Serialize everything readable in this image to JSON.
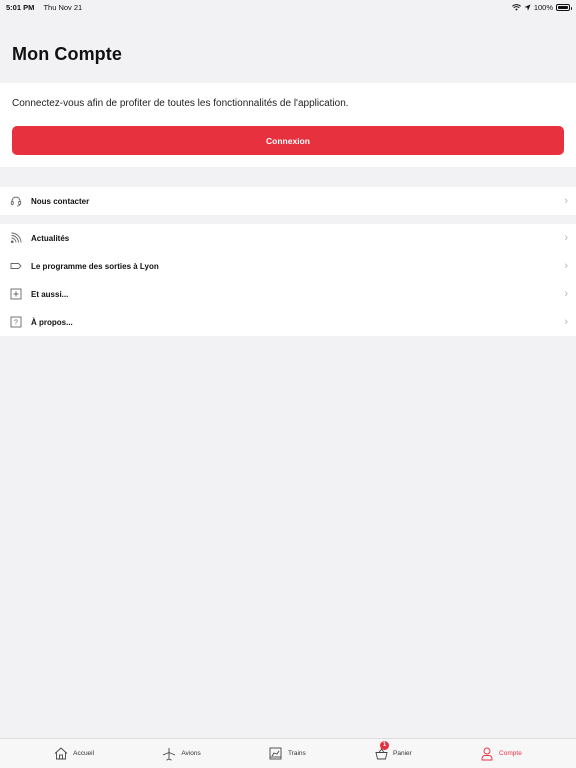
{
  "status_bar": {
    "time": "5:01 PM",
    "date": "Thu Nov 21",
    "battery": "100%"
  },
  "page_title": "Mon Compte",
  "login": {
    "message": "Connectez-vous afin de profiter de toutes les fonctionnalités de l'application.",
    "button_label": "Connexion"
  },
  "menu_contact": [
    {
      "label": "Nous contacter",
      "icon": "headset-icon"
    }
  ],
  "menu_main": [
    {
      "label": "Actualités",
      "icon": "rss-icon"
    },
    {
      "label": "Le programme des sorties à Lyon",
      "icon": "tag-icon"
    },
    {
      "label": "Et aussi...",
      "icon": "plus-box-icon"
    },
    {
      "label": "À propos...",
      "icon": "question-box-icon"
    }
  ],
  "tab_bar": [
    {
      "label": "Accueil",
      "icon": "home-icon"
    },
    {
      "label": "Avions",
      "icon": "plane-icon"
    },
    {
      "label": "Trains",
      "icon": "train-icon"
    },
    {
      "label": "Panier",
      "icon": "basket-icon",
      "badge": "1"
    },
    {
      "label": "Compte",
      "icon": "user-icon",
      "active": true
    }
  ],
  "colors": {
    "accent": "#e8313e",
    "background": "#f2f2f4"
  }
}
